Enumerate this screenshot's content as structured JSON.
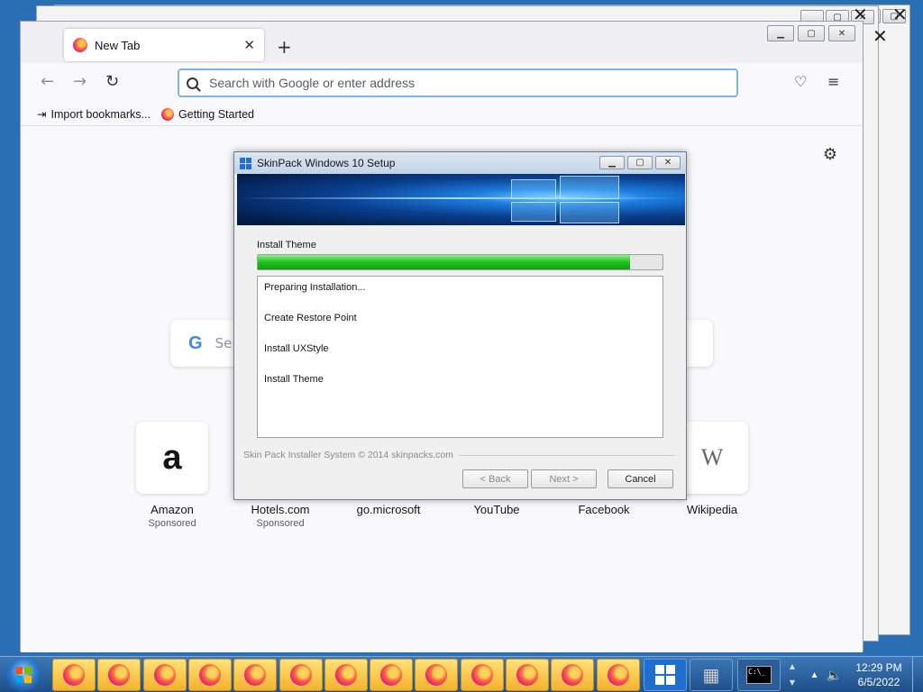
{
  "firefox": {
    "tab_title": "New Tab",
    "url_placeholder": "Search with Google or enter address",
    "bookmarks": [
      "Import bookmarks...",
      "Getting Started"
    ],
    "search_placeholder": "Se",
    "tiles": [
      {
        "name": "Amazon",
        "sponsored": "Sponsored",
        "icon": "a"
      },
      {
        "name": "Hotels.com",
        "sponsored": "Sponsored",
        "icon": ""
      },
      {
        "name": "go.microsoft",
        "sponsored": "",
        "icon": ""
      },
      {
        "name": "YouTube",
        "sponsored": "",
        "icon": ""
      },
      {
        "name": "Facebook",
        "sponsored": "",
        "icon": ""
      },
      {
        "name": "Wikipedia",
        "sponsored": "",
        "icon": "W"
      }
    ]
  },
  "dialog": {
    "title": "SkinPack Windows 10 Setup",
    "stage_label": "Install Theme",
    "progress": 0.92,
    "steps": [
      "Preparing Installation...",
      "Create Restore Point",
      "Install UXStyle",
      "Install Theme"
    ],
    "footer": "Skin Pack Installer System © 2014 skinpacks.com",
    "back_label": "< Back",
    "next_label": "Next >",
    "cancel_label": "Cancel"
  },
  "taskbar": {
    "time": "12:29 PM",
    "date": "6/5/2022",
    "firefox_button_count": 13
  }
}
